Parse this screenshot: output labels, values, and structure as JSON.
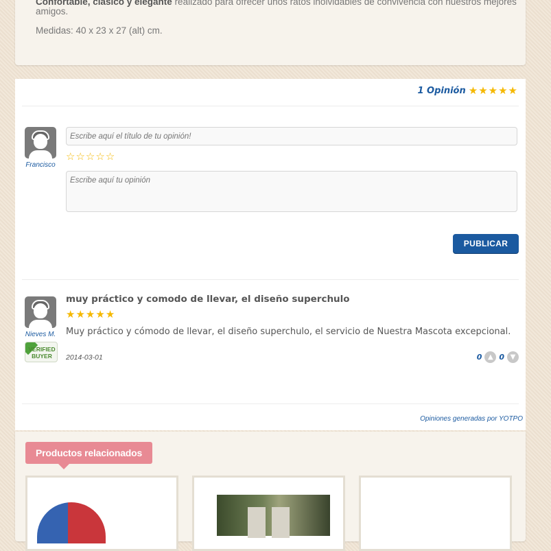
{
  "description": {
    "line1_bold": "Confortable, clásico y elegante",
    "line1_rest": " realizado para ofrecer unos ratos inolvidables de convivencia con nuestros mejores",
    "line2": "amigos.",
    "measures": "Medidas: 40 x 23 x 27 (alt) cm."
  },
  "reviews_summary": {
    "count_label": "1 Opinión",
    "rating": 5
  },
  "write_review": {
    "user_name": "Francisco",
    "title_placeholder": "Escribe aquí el título de tu opinión!",
    "body_placeholder": "Escribe aquí tu opinión",
    "rating": 0,
    "publish_label": "PUBLICAR"
  },
  "review": {
    "author": "Nieves M.",
    "badge_line1": "VERIFIED",
    "badge_line2": "BUYER",
    "title": "muy práctico y comodo de llevar, el diseño superchulo",
    "rating": 5,
    "body": "Muy práctico y cómodo de llevar, el diseño superchulo, el servicio de Nuestra Mascota excepcional.",
    "date": "2014-03-01",
    "votes_up": "0",
    "votes_down": "0"
  },
  "powered_by": "Opiniones generadas por YOTPO",
  "related": {
    "title": "Productos relacionados"
  },
  "colors": {
    "accent": "#1b5aa0",
    "star": "#f5b800",
    "related_tag": "#e88a94"
  }
}
